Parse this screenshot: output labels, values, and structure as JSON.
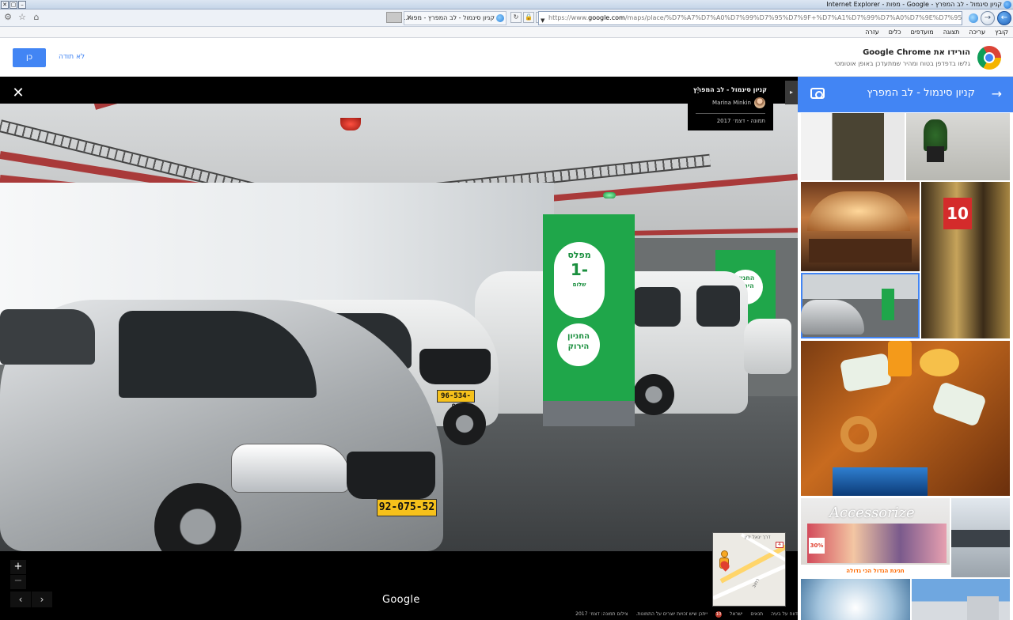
{
  "window": {
    "title": "קניון סינמול - לב המפרץ - Google - מפות - Internet Explorer",
    "controls": [
      "✕",
      "▢",
      "–"
    ]
  },
  "tab": {
    "title": "קניון סינמול - לב המפרץ - מפות...",
    "close": "✕"
  },
  "address": {
    "scheme": "https://www.",
    "host": "google.com",
    "path": "/maps/place/%D7%A7%D7%A0%D7%99%D7%95%D7%9F+%D7%A1%D7%99%D7%A0%D7%9E%D7%95%D7%9C+-+%D7%9C"
  },
  "menu": [
    "קובץ",
    "עריכה",
    "תצוגה",
    "מועדפים",
    "כלים",
    "עזרה"
  ],
  "promo": {
    "title": "הורידו את Google Chrome",
    "subtitle": "גלשו בדפדפן בטוח ומהיר שמתעדכן באופן אוטומטי",
    "yes_label": "כן",
    "no_label": "לא תודה"
  },
  "viewer": {
    "close_label": "✕",
    "place_title": "קניון סינמול - לב המפרץ",
    "author": "Marina Minkin",
    "photo_date": "תמונה - דצמ׳ 2017",
    "more_icon": "⋮",
    "collapse_icon": "▸",
    "zoom_in": "+",
    "zoom_out": "−",
    "prev": "‹",
    "next": "›",
    "brand": "Google",
    "photo": {
      "sign_lines": [
        "מפלס",
        "1-",
        "שלום",
        "החניון",
        "הירוק"
      ],
      "plate_front": "92-075-52",
      "plate_rear": "96-534-91"
    },
    "minimap": {
      "road_label": "דרך יגאל ידין",
      "street_label": "רחוב",
      "badge": "4"
    },
    "footer": {
      "photo_credit": "צילום תמונה: דצמ׳ 2017",
      "rights": "ייתכן שיש זכויות יוצרים על התמונות.",
      "badge": "10",
      "country": "ישראל",
      "terms": "תנאים",
      "report": "דווח על בעיה"
    }
  },
  "panel": {
    "title": "קניון סינמול - לב המפרץ",
    "back_icon": "→",
    "camera_icon": "camera-icon",
    "thumb_sale_text": "10",
    "thumb_store_name": "Accessorize",
    "thumb_store_banner": "חגיגת הגדול הכי גדולה",
    "thumb_store_sale": "30%"
  },
  "colors": {
    "accent": "#4285f4",
    "pillar_green": "#1fa64a",
    "pipe_red": "#a93a3a"
  }
}
